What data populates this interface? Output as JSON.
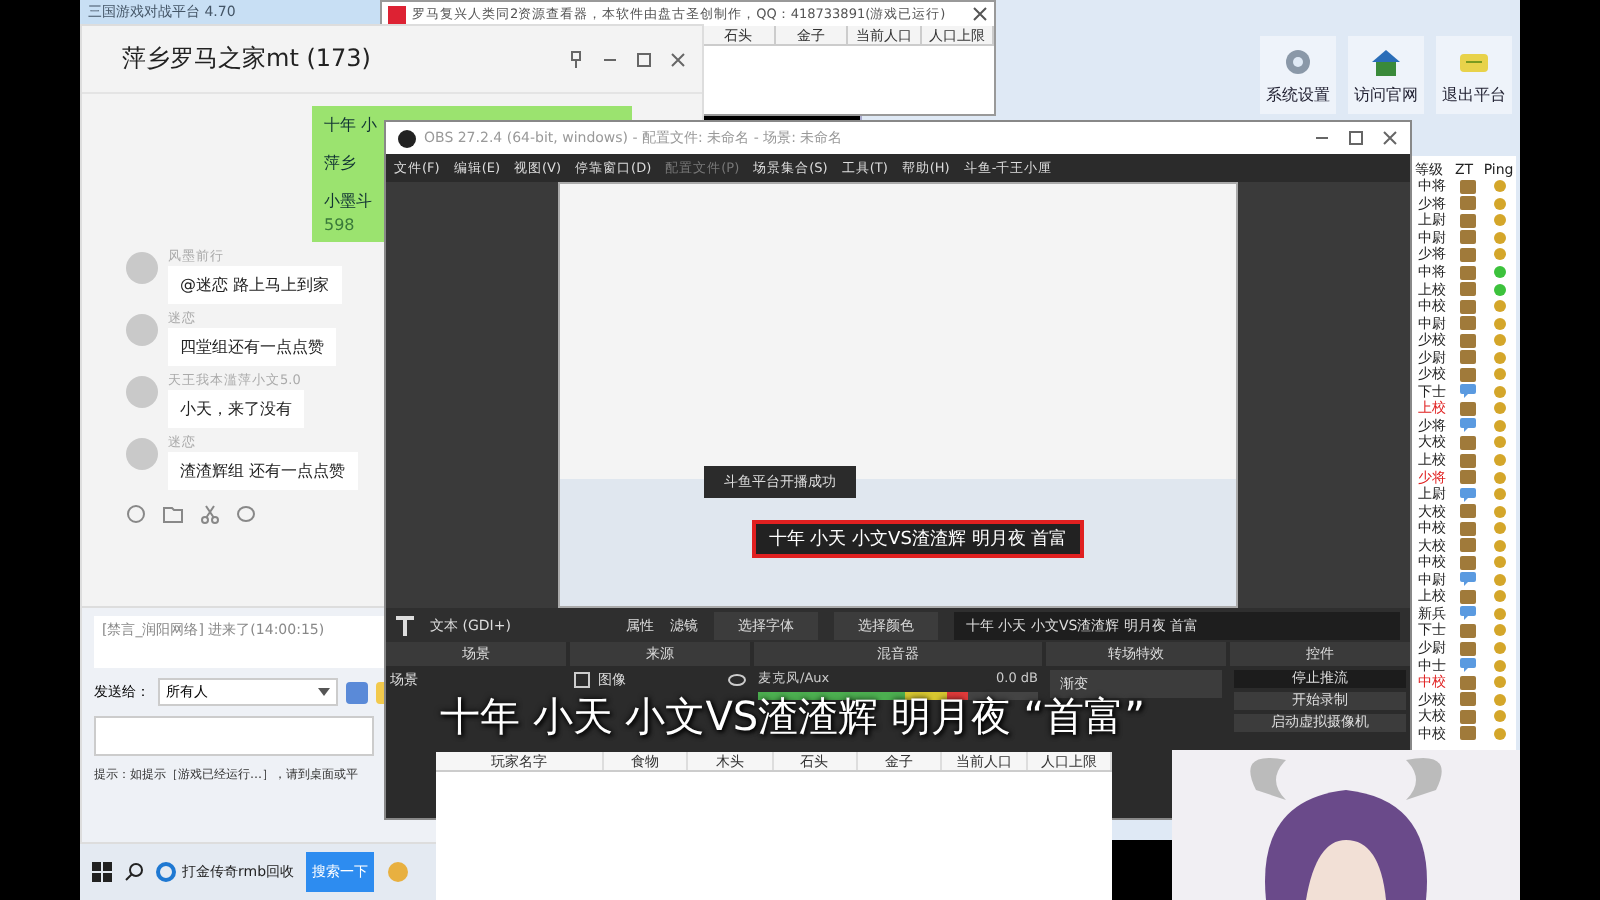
{
  "back_window": {
    "title": "三国游戏对战平台 4.70"
  },
  "resource_viewer": {
    "title": "罗马复兴人类同2资源查看器，本软件由盘古圣创制作，QQ：418733891(游戏已运行)",
    "columns": [
      "石头",
      "金子",
      "当前人口",
      "人口上限"
    ]
  },
  "platform": {
    "buttons": [
      {
        "label": "系统设置"
      },
      {
        "label": "访问官网"
      },
      {
        "label": "退出平台"
      }
    ],
    "list_columns": [
      "等级",
      "ZT",
      "Ping"
    ],
    "players": [
      {
        "rank": "中将",
        "highlighted": false,
        "kind": "crate",
        "color": "#d4a62a"
      },
      {
        "rank": "少将",
        "highlighted": false,
        "kind": "crate",
        "color": "#d4a62a"
      },
      {
        "rank": "上尉",
        "highlighted": false,
        "kind": "crate",
        "color": "#d4a62a"
      },
      {
        "rank": "中尉",
        "highlighted": false,
        "kind": "crate",
        "color": "#d4a62a"
      },
      {
        "rank": "少将",
        "highlighted": false,
        "kind": "crate",
        "color": "#d4a62a"
      },
      {
        "rank": "中将",
        "highlighted": false,
        "kind": "crate",
        "color": "#3cc23c"
      },
      {
        "rank": "上校",
        "highlighted": false,
        "kind": "crate",
        "color": "#3cc23c"
      },
      {
        "rank": "中校",
        "highlighted": false,
        "kind": "crate",
        "color": "#d4a62a"
      },
      {
        "rank": "中尉",
        "highlighted": false,
        "kind": "crate",
        "color": "#d4a62a"
      },
      {
        "rank": "少校",
        "highlighted": false,
        "kind": "crate",
        "color": "#d4a62a"
      },
      {
        "rank": "少尉",
        "highlighted": false,
        "kind": "crate",
        "color": "#d4a62a"
      },
      {
        "rank": "少校",
        "highlighted": false,
        "kind": "crate",
        "color": "#d4a62a"
      },
      {
        "rank": "下士",
        "highlighted": false,
        "kind": "bubble",
        "color": "#d4a62a"
      },
      {
        "rank": "上校",
        "highlighted": true,
        "kind": "crate",
        "color": "#d4a62a"
      },
      {
        "rank": "少将",
        "highlighted": false,
        "kind": "bubble",
        "color": "#d4a62a"
      },
      {
        "rank": "大校",
        "highlighted": false,
        "kind": "crate",
        "color": "#d4a62a"
      },
      {
        "rank": "上校",
        "highlighted": false,
        "kind": "crate",
        "color": "#d4a62a"
      },
      {
        "rank": "少将",
        "highlighted": true,
        "kind": "crate",
        "color": "#d4a62a"
      },
      {
        "rank": "上尉",
        "highlighted": false,
        "kind": "bubble",
        "color": "#d4a62a"
      },
      {
        "rank": "大校",
        "highlighted": false,
        "kind": "crate",
        "color": "#d4a62a"
      },
      {
        "rank": "中校",
        "highlighted": false,
        "kind": "crate",
        "color": "#d4a62a"
      },
      {
        "rank": "大校",
        "highlighted": false,
        "kind": "crate",
        "color": "#d4a62a"
      },
      {
        "rank": "中校",
        "highlighted": false,
        "kind": "crate",
        "color": "#d4a62a"
      },
      {
        "rank": "中尉",
        "highlighted": false,
        "kind": "bubble",
        "color": "#d4a62a"
      },
      {
        "rank": "上校",
        "highlighted": false,
        "kind": "crate",
        "color": "#d4a62a"
      },
      {
        "rank": "新兵",
        "highlighted": false,
        "kind": "bubble",
        "color": "#d4a62a"
      },
      {
        "rank": "下士",
        "highlighted": false,
        "kind": "crate",
        "color": "#d4a62a"
      },
      {
        "rank": "少尉",
        "highlighted": false,
        "kind": "crate",
        "color": "#d4a62a"
      },
      {
        "rank": "中士",
        "highlighted": false,
        "kind": "bubble",
        "color": "#d4a62a"
      },
      {
        "rank": "中校",
        "highlighted": true,
        "kind": "crate",
        "color": "#d4a62a"
      },
      {
        "rank": "少校",
        "highlighted": false,
        "kind": "crate",
        "color": "#d4a62a"
      },
      {
        "rank": "大校",
        "highlighted": false,
        "kind": "crate",
        "color": "#d4a62a"
      },
      {
        "rank": "中校",
        "highlighted": false,
        "kind": "crate",
        "color": "#d4a62a"
      }
    ]
  },
  "chat": {
    "title": "萍乡罗马之家mt (173)",
    "own_lines": [
      "十年 小",
      "萍乡",
      "小墨斗",
      "598"
    ],
    "messages": [
      {
        "sender": "风墨前行",
        "text": "@迷恋 路上马上到家"
      },
      {
        "sender": "迷恋",
        "text": "四堂组还有一点点赞"
      },
      {
        "sender": "天王我本滥萍小文5.0",
        "text": "小天，来了没有"
      },
      {
        "sender": "迷恋",
        "text": "渣渣辉组 还有一点点赞"
      }
    ],
    "notice": "[禁言_润阳网络] 进来了(14:00:15)",
    "send_to_label": "发送给：",
    "send_to_value": "所有人",
    "hint": "提示：如提示［游戏已经运行…］，请到桌面或平"
  },
  "obs": {
    "title": "OBS 27.2.4 (64-bit, windows) - 配置文件: 未命名 - 场景: 未命名",
    "menu": [
      {
        "label": "文件(F)",
        "disabled": false
      },
      {
        "label": "编辑(E)",
        "disabled": false
      },
      {
        "label": "视图(V)",
        "disabled": false
      },
      {
        "label": "停靠窗口(D)",
        "disabled": false
      },
      {
        "label": "配置文件(P)",
        "disabled": true
      },
      {
        "label": "场景集合(S)",
        "disabled": false
      },
      {
        "label": "工具(T)",
        "disabled": false
      },
      {
        "label": "帮助(H)",
        "disabled": false
      },
      {
        "label": "斗鱼-千王小厘",
        "disabled": false
      }
    ],
    "toast": "斗鱼平台开播成功",
    "preview_text": "十年 小天 小文VS渣渣辉 明月夜 首富",
    "source_label": "文本 (GDI+)",
    "tool_buttons": [
      "属性",
      "滤镜",
      "选择字体",
      "选择颜色"
    ],
    "text_value": "十年 小天 小文VS渣渣辉 明月夜 首富",
    "docks": [
      "场景",
      "来源",
      "混音器",
      "转场特效",
      "控件"
    ],
    "scenes": [
      "场景"
    ],
    "sources": [
      "图像"
    ],
    "mixer": {
      "name": "麦克风/Aux",
      "reading": "0.0 dB",
      "level": 0.75
    },
    "transition": "渐变",
    "controls": [
      "停止推流",
      "开始录制",
      "启动虚拟摄像机"
    ]
  },
  "overlay_caption": "十年  小天 小文VS渣渣辉  明月夜 “首富”",
  "game_table": {
    "columns": [
      "玩家名字",
      "食物",
      "木头",
      "石头",
      "金子",
      "当前人口",
      "人口上限"
    ]
  },
  "taskbar": {
    "items": [
      {
        "kind": "search-result",
        "label": "打金传奇rmb回收"
      },
      {
        "kind": "button",
        "label": "搜索一下"
      }
    ]
  }
}
